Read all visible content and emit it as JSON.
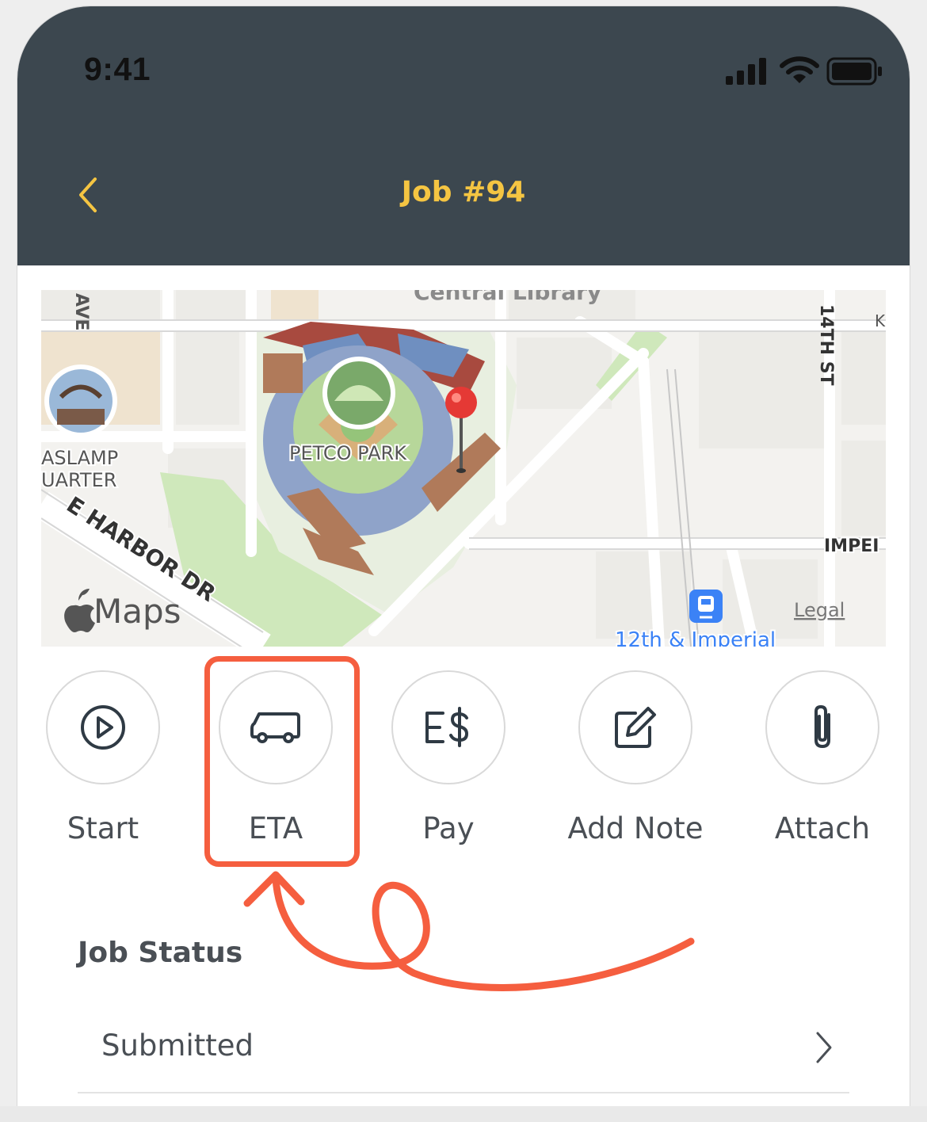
{
  "status_bar": {
    "time": "9:41"
  },
  "header": {
    "title": "Job #94",
    "back_icon": "chevron-left-icon"
  },
  "map": {
    "labels": {
      "stadium": "PETCO PARK",
      "district_line1": "ASLAMP",
      "district_line2": "UARTER",
      "street_diag": "E HARBOR DR",
      "street_right": "14TH ST",
      "street_imperial": "IMPEI",
      "station": "12th & Imperial",
      "ave": "AVE",
      "top_partial": "Central Library",
      "k_partial": "K",
      "brand": "Maps",
      "legal": "Legal"
    },
    "pin_color": "#e53935"
  },
  "actions": [
    {
      "id": "start",
      "label": "Start",
      "icon": "play-circle-icon"
    },
    {
      "id": "eta",
      "label": "ETA",
      "icon": "van-icon"
    },
    {
      "id": "pay",
      "label": "Pay",
      "icon": "pay-icon"
    },
    {
      "id": "add_note",
      "label": "Add Note",
      "icon": "edit-note-icon"
    },
    {
      "id": "attach",
      "label": "Attach",
      "icon": "paperclip-icon"
    }
  ],
  "annotation": {
    "color": "#f55e3f"
  },
  "job_status": {
    "title": "Job Status",
    "value": "Submitted"
  },
  "colors": {
    "header_bg": "#3c474f",
    "title_accent": "#f5c542",
    "text": "#4a4f55"
  }
}
